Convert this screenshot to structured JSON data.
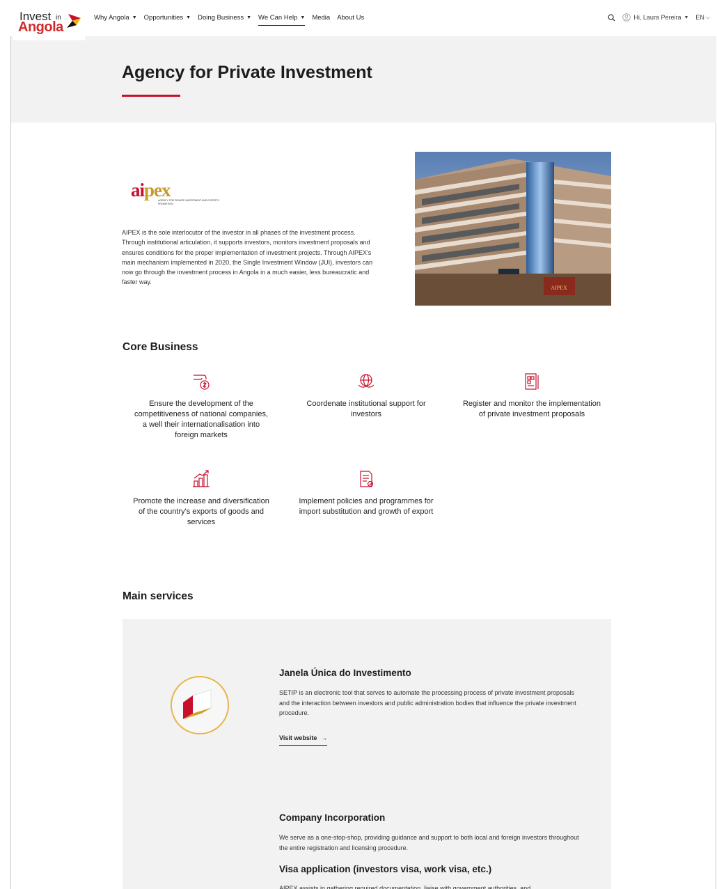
{
  "header": {
    "logo": {
      "line1": "Invest",
      "line1_small": "in",
      "line2": "Angola"
    },
    "nav": [
      {
        "label": "Why Angola",
        "dropdown": true
      },
      {
        "label": "Opportunities",
        "dropdown": true
      },
      {
        "label": "Doing Business",
        "dropdown": true
      },
      {
        "label": "We Can Help",
        "dropdown": true,
        "active": true
      },
      {
        "label": "Media",
        "dropdown": false
      },
      {
        "label": "About Us",
        "dropdown": false
      }
    ],
    "user_greeting": "Hi, Laura Pereira",
    "language": "EN",
    "icons": {
      "search": "search-icon",
      "user": "user-icon"
    }
  },
  "hero": {
    "title": "Agency for Private Investment"
  },
  "intro": {
    "logo_word_a": "ai",
    "logo_word_b": "pex",
    "logo_subtitle": "AGENCY FOR PRIVATE INVESTMENT AND EXPORTS PROMOTION",
    "text": "AIPEX is the sole interlocutor of the investor in all phases of the investment process. Through institutional articulation, it supports investors, monitors investment proposals and ensures conditions for the proper implementation of investment projects. Through AIPEX's main mechanism implemented in 2020, the Single Investment Window (JUI), investors can now go through the investment process in Angola in a much easier, less bureaucratic and faster way."
  },
  "core_business": {
    "title": "Core Business",
    "items": [
      {
        "icon": "money-hand-icon",
        "text": "Ensure the development of the competitiveness of national companies, a well their internationalisation into foreign markets"
      },
      {
        "icon": "globe-hands-icon",
        "text": "Coordenate institutional support for investors"
      },
      {
        "icon": "document-register-icon",
        "text": "Register and monitor the implementation of private investment proposals"
      },
      {
        "icon": "growth-chart-icon",
        "text": "Promote the increase and diversification of the country's exports of goods and services"
      },
      {
        "icon": "policy-document-icon",
        "text": "Implement policies and programmes for import substitution and growth of export"
      }
    ]
  },
  "main_services": {
    "title": "Main services",
    "items": [
      {
        "title": "Janela Única do Investimento",
        "text": "SETIP is an electronic tool that serves to automate the processing process of private investment proposals and the interaction between investors and public administration bodies that influence the private investment procedure.",
        "link": "Visit website",
        "link_arrow": "→"
      },
      {
        "title": "Company Incorporation",
        "text": "We serve as a one-stop-shop, providing guidance and support to both local and foreign investors throughout the entire registration and licensing procedure."
      },
      {
        "title": "Visa application (investors visa, work visa, etc.)",
        "text": "AIPEX assists in gathering required documentation, liaise with government authorities, and"
      }
    ]
  },
  "colors": {
    "accent_red": "#c8102e",
    "gold": "#e7b64a",
    "hero_bg": "#f2f2f2"
  }
}
